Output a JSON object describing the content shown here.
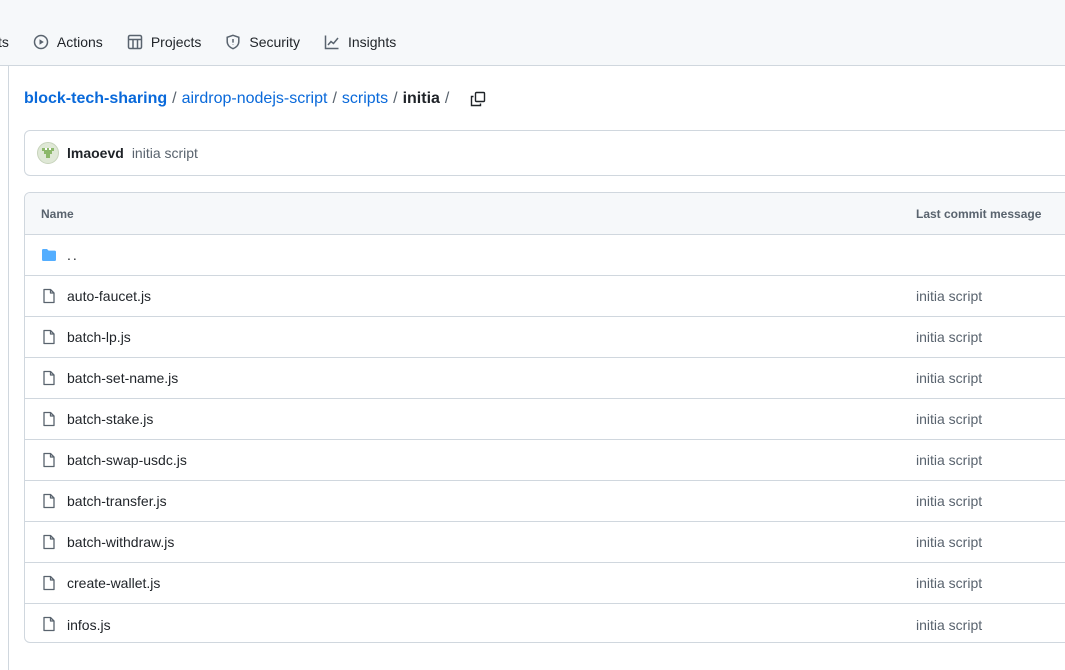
{
  "nav": {
    "partial_label": "ts",
    "items": [
      {
        "label": "Actions",
        "icon": "play-circle-icon"
      },
      {
        "label": "Projects",
        "icon": "table-icon"
      },
      {
        "label": "Security",
        "icon": "shield-icon"
      },
      {
        "label": "Insights",
        "icon": "graph-icon"
      }
    ]
  },
  "breadcrumb": {
    "repo": "block-tech-sharing",
    "separator": "/",
    "parts": [
      "airdrop-nodejs-script",
      "scripts"
    ],
    "current": "initia",
    "trailing": "/"
  },
  "commit": {
    "author": "lmaoevd",
    "message": "initia script"
  },
  "table": {
    "headers": {
      "name": "Name",
      "last_commit": "Last commit message"
    },
    "parent_dir": "..",
    "files": [
      {
        "name": "auto-faucet.js",
        "message": "initia script"
      },
      {
        "name": "batch-lp.js",
        "message": "initia script"
      },
      {
        "name": "batch-set-name.js",
        "message": "initia script"
      },
      {
        "name": "batch-stake.js",
        "message": "initia script"
      },
      {
        "name": "batch-swap-usdc.js",
        "message": "initia script"
      },
      {
        "name": "batch-transfer.js",
        "message": "initia script"
      },
      {
        "name": "batch-withdraw.js",
        "message": "initia script"
      },
      {
        "name": "create-wallet.js",
        "message": "initia script"
      },
      {
        "name": "infos.js",
        "message": "initia script"
      }
    ]
  },
  "colors": {
    "link": "#0969da",
    "folder": "#54aeff",
    "muted": "#59636e",
    "border": "#d0d7de"
  }
}
